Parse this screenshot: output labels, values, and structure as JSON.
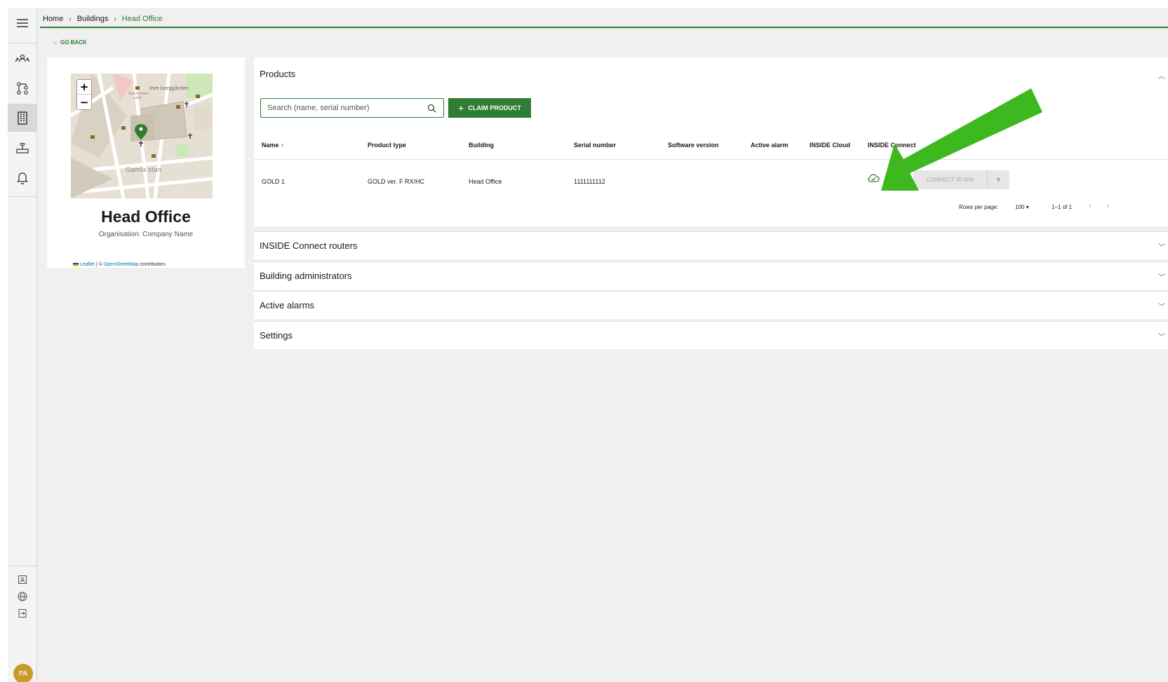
{
  "breadcrumb": {
    "home": "Home",
    "buildings": "Buildings",
    "current": "Head Office"
  },
  "go_back": "GO BACK",
  "building_card": {
    "name": "Head Office",
    "organisation": "Organisation: Company Name",
    "map_attribution": {
      "leaflet": "Leaflet",
      "sep": " | © ",
      "osm": "OpenStreetMap",
      "contrib": " contributors"
    },
    "map_labels": [
      "Inre borggården",
      "Gamla stan",
      "Stockholms slott"
    ]
  },
  "products": {
    "title": "Products",
    "search_placeholder": "Search (name, serial number)",
    "claim_label": "CLAIM PRODUCT",
    "columns": [
      "Name",
      "Product type",
      "Building",
      "Serial number",
      "Software version",
      "Active alarm",
      "INSIDE Cloud",
      "INSIDE Connect"
    ],
    "rows": [
      {
        "name": "GOLD 1",
        "product_type": "GOLD ver. F RX/HC",
        "building": "Head Office",
        "serial": "1111111112",
        "software": "",
        "alarm": "",
        "cloud_icon": "cloud-check-icon",
        "connect_label": "CONNECT 30 MIN"
      }
    ],
    "pager": {
      "rows_per_page_label": "Rows per page:",
      "rows_per_page_value": "100",
      "range": "1–1 of 1"
    }
  },
  "sections": {
    "routers": "INSIDE Connect routers",
    "admins": "Building administrators",
    "alarms": "Active alarms",
    "settings": "Settings"
  },
  "user": {
    "initials": "PA",
    "avatar_color": "#c99a2e"
  },
  "colors": {
    "accent": "#2e7d32",
    "annotation_arrow": "#3db81f"
  }
}
